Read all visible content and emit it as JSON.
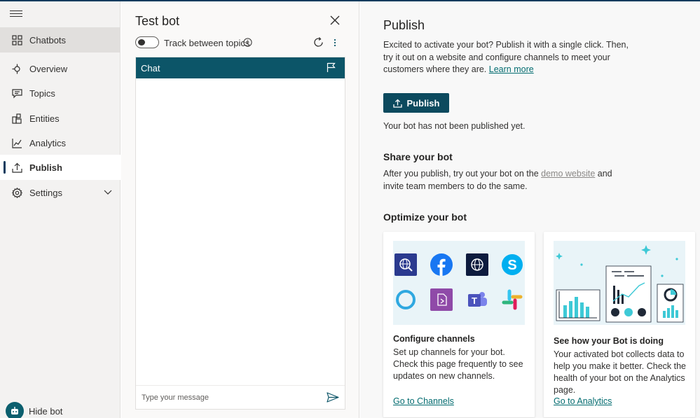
{
  "sidebar": {
    "items": [
      {
        "label": "Chatbots",
        "icon": "grid-icon"
      },
      {
        "label": "Overview",
        "icon": "overview-icon"
      },
      {
        "label": "Topics",
        "icon": "chat-bubble-icon"
      },
      {
        "label": "Entities",
        "icon": "entities-icon"
      },
      {
        "label": "Analytics",
        "icon": "line-chart-icon"
      },
      {
        "label": "Publish",
        "icon": "upload-icon"
      },
      {
        "label": "Settings",
        "icon": "gear-icon"
      }
    ],
    "active": "Publish",
    "hide_bot_label": "Hide bot"
  },
  "test_bot": {
    "title": "Test bot",
    "track_label": "Track between topics",
    "chat_header": "Chat",
    "input_placeholder": "Type your message"
  },
  "main": {
    "title": "Publish",
    "intro_line1": "Excited to activate your bot? Publish it with a single click. Then,",
    "intro_line2": "try it out on a website and configure channels to meet your",
    "intro_line3": "customers where they are. ",
    "learn_more": "Learn more",
    "publish_button": "Publish",
    "status": "Your bot has not been published yet.",
    "share_title": "Share your bot",
    "share_line1_a": "After you publish, try out your bot on the ",
    "share_link": "demo website",
    "share_line1_b": " and",
    "share_line2": "invite team members to do the same.",
    "optimize_title": "Optimize your bot",
    "cards": [
      {
        "title": "Configure channels",
        "text": "Set up channels for your bot. Check this page frequently to see updates on new channels.",
        "link": "Go to Channels"
      },
      {
        "title": "See how your Bot is doing",
        "text": "Your activated bot collects data to help you make it better. Check the health of your bot on the Analytics page.",
        "link": "Go to Analytics"
      }
    ]
  },
  "colors": {
    "accent": "#0c4a5e",
    "chat_header": "#0c5568",
    "link": "#036c70"
  }
}
